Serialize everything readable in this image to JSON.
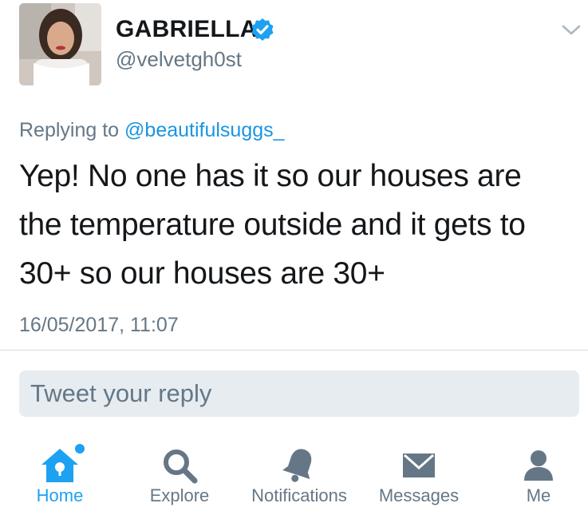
{
  "author": {
    "display_name": "GABRIELLA",
    "handle": "@velvetgh0st",
    "verified": true
  },
  "tweet": {
    "replying_prefix": "Replying to",
    "replying_to": "@beautifulsuggs_",
    "text": "Yep! No one has it so our houses are the temperature outside and it gets to 30+ so our houses are 30+",
    "timestamp": "16/05/2017, 11:07"
  },
  "reply": {
    "placeholder": "Tweet your reply"
  },
  "tabbar": {
    "items": [
      {
        "label": "Home",
        "icon": "home-icon",
        "active": true
      },
      {
        "label": "Explore",
        "icon": "search-icon",
        "active": false
      },
      {
        "label": "Notifications",
        "icon": "bell-icon",
        "active": false
      },
      {
        "label": "Messages",
        "icon": "envelope-icon",
        "active": false
      },
      {
        "label": "Me",
        "icon": "person-icon",
        "active": false
      }
    ]
  },
  "colors": {
    "accent": "#1da1f2",
    "mention": "#1b95e0",
    "secondary_text": "#657786",
    "reply_box_bg": "#e6ecf0"
  }
}
